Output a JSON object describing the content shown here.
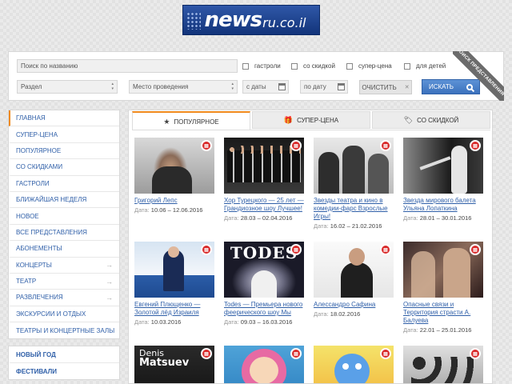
{
  "logo": {
    "news": "news",
    "domain": "ru.co.il"
  },
  "search": {
    "name_placeholder": "Поиск по названию",
    "section": "Раздел",
    "venue": "Место проведения",
    "date_from": "с даты",
    "date_to": "по дату",
    "checks": [
      "гастроли",
      "со скидкой",
      "супер-цена",
      "для детей"
    ],
    "clear_label": "ОЧИСТИТЬ",
    "clear_x": "✕",
    "search_label": "ИСКАТЬ",
    "ribbon": "ПОИСК ПРЕДСТАВЛЕНИЯ"
  },
  "sidebar": {
    "items": [
      {
        "label": "ГЛАВНАЯ",
        "arrow": ""
      },
      {
        "label": "СУПЕР-ЦЕНА",
        "arrow": ""
      },
      {
        "label": "ПОПУЛЯРНОЕ",
        "arrow": ""
      },
      {
        "label": "СО СКИДКАМИ",
        "arrow": ""
      },
      {
        "label": "ГАСТРОЛИ",
        "arrow": ""
      },
      {
        "label": "БЛИЖАЙШАЯ НЕДЕЛЯ",
        "arrow": ""
      },
      {
        "label": "НОВОЕ",
        "arrow": ""
      },
      {
        "label": "ВСЕ ПРЕДСТАВЛЕНИЯ",
        "arrow": ""
      },
      {
        "label": "АБОНЕМЕНТЫ",
        "arrow": ""
      },
      {
        "label": "КОНЦЕРТЫ",
        "arrow": "→"
      },
      {
        "label": "ТЕАТР",
        "arrow": "→"
      },
      {
        "label": "РАЗВЛЕЧЕНИЯ",
        "arrow": "→"
      },
      {
        "label": "ЭКСКУРСИИ И ОТДЫХ",
        "arrow": ""
      },
      {
        "label": "ТЕАТРЫ И КОНЦЕРТНЫЕ ЗАЛЫ",
        "arrow": ""
      }
    ],
    "extra": [
      "НОВЫЙ ГОД",
      "ФЕСТИВАЛИ"
    ]
  },
  "tabs": [
    {
      "label": "ПОПУЛЯРНОЕ",
      "icon": "★"
    },
    {
      "label": "СУПЕР-ЦЕНА",
      "icon": "🎁"
    },
    {
      "label": "СО СКИДКОЙ",
      "icon": "🏷"
    }
  ],
  "date_label": "Дата:",
  "cards": [
    {
      "title": "Григорий Лепс",
      "date": "10.06 – 12.06.2016"
    },
    {
      "title": "Хор Турецкого — 25 лет — Грандиозное шоу Лучшее!",
      "date": "28.03 – 02.04.2016"
    },
    {
      "title": "Звезды театра и кино в комедии-фарс Взрослые Игры!",
      "date": "16.02 – 21.02.2016"
    },
    {
      "title": "Звезда мирового балета Ульяна Лопаткина",
      "date": "28.01 – 30.01.2016"
    },
    {
      "title": "Евгений Плющенко — Золотой лёд Израиля",
      "date": "10.03.2016"
    },
    {
      "title": "Todes — Премьера нового феерического шоу Мы",
      "date": "09.03 – 16.03.2016"
    },
    {
      "title": "Алессандро Сафина",
      "date": "18.02.2016"
    },
    {
      "title": "Опасные связи и Территория страсти А. Балуева",
      "date": "22.01 – 25.01.2016"
    }
  ],
  "badge_text": "▤",
  "thumb_text": {
    "todes": "TODES",
    "denis": "Denis",
    "matsuev": "Matsuev"
  }
}
